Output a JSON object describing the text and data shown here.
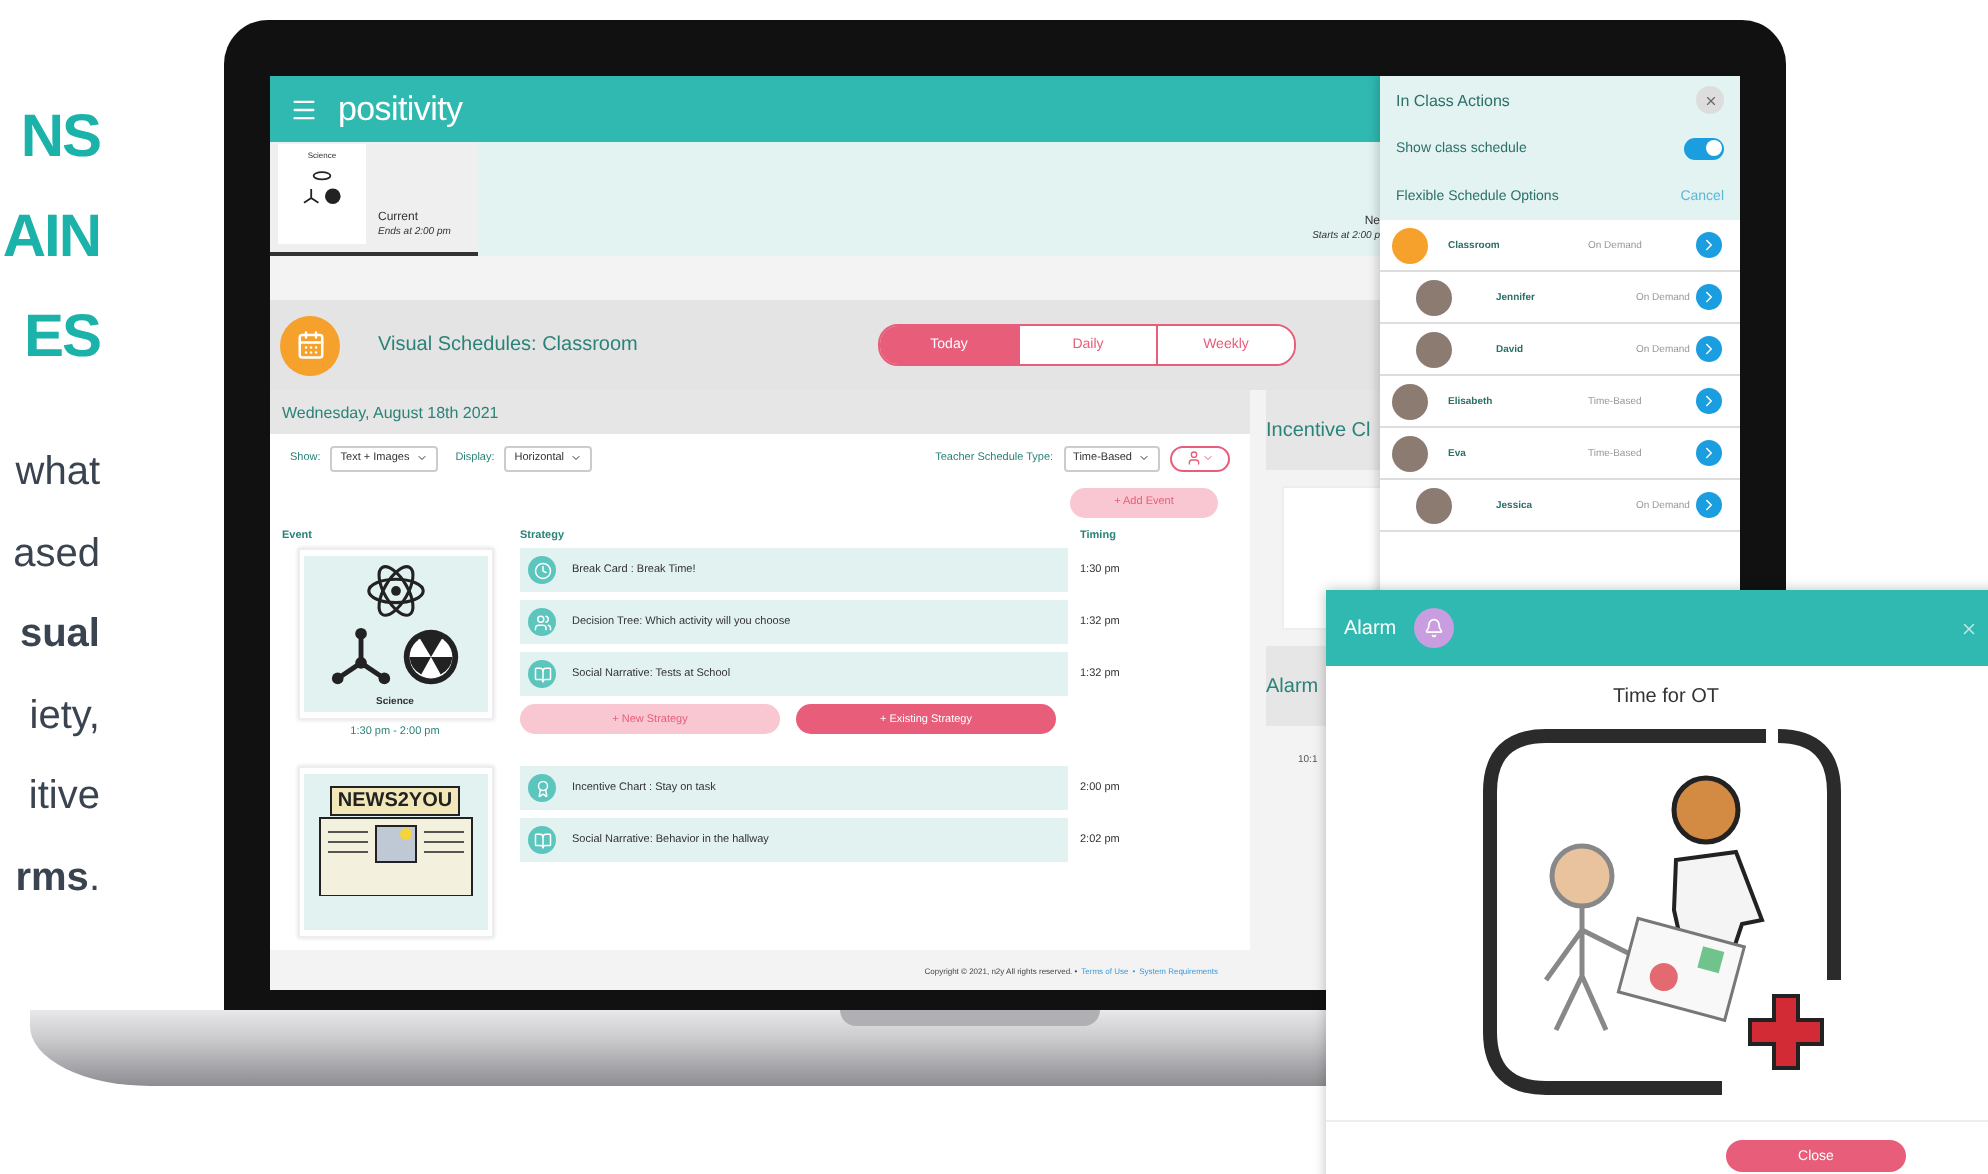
{
  "headline": [
    "NS",
    "AIN",
    "ES"
  ],
  "intro_lines": [
    {
      "text": "what",
      "bold": false
    },
    {
      "text": "ased",
      "bold": false
    },
    {
      "text": "sual",
      "bold": true
    },
    {
      "text": "iety,",
      "bold": false
    },
    {
      "text": "itive",
      "bold": false
    },
    {
      "text": "**rms**.",
      "bold": false
    }
  ],
  "app": {
    "logo": "positivity",
    "current": {
      "event": "Science",
      "label": "Current",
      "time": "Ends at 2:00 pm"
    },
    "next": {
      "label": "Ne",
      "time": "Starts at 2:00 p"
    },
    "title": "Visual Schedules: Classroom",
    "tabs": [
      {
        "label": "Today",
        "selected": true
      },
      {
        "label": "Daily",
        "selected": false
      },
      {
        "label": "Weekly",
        "selected": false
      }
    ],
    "date": "Wednesday, August 18th 2021",
    "filters": [
      {
        "label": "Show:",
        "value": "Text + Images"
      },
      {
        "label": "Display:",
        "value": "Horizontal"
      }
    ],
    "schedule_type": {
      "label": "Teacher Schedule Type:",
      "value": "Time-Based"
    },
    "add_event": "+ Add Event",
    "columns": [
      "Event",
      "Strategy",
      "Timing"
    ],
    "events": [
      {
        "kind": "science",
        "name": "Science",
        "time": "1:30 pm - 2:00 pm",
        "strategies": [
          {
            "kind": "break_card",
            "text": "Break Card : Break Time!",
            "time": "1:30 pm"
          },
          {
            "kind": "decision_tree",
            "text": "Decision Tree: Which activity will you choose",
            "time": "1:32 pm"
          },
          {
            "kind": "social_narrative",
            "text": "Social Narrative: Tests at School",
            "time": "1:32 pm"
          }
        ],
        "buttons": [
          "+ New Strategy",
          "+ Existing Strategy"
        ]
      },
      {
        "kind": "news",
        "name": "NEWS2YOU",
        "strategies": [
          {
            "kind": "incentive_chart",
            "text": "Incentive Chart : Stay on task",
            "time": "2:00 pm"
          },
          {
            "kind": "social_narrative",
            "text": "Social Narrative: Behavior in the hallway",
            "time": "2:02 pm"
          }
        ]
      }
    ],
    "side": {
      "incentive": "Incentive Cl",
      "alarms": "Alarm",
      "alarm_time": "10:1"
    },
    "footer": {
      "text": "Copyright © 2021, n2y All rights reserved. •",
      "links": [
        "Terms of Use",
        "System Requirements"
      ],
      "separator": "•"
    }
  },
  "panel": {
    "title": "In Class Actions",
    "toggle": {
      "label": "Show class schedule",
      "on": true
    },
    "options_label": "Flexible Schedule Options",
    "cancel": "Cancel",
    "items": [
      {
        "kind": "class",
        "name": "Classroom",
        "type": "On Demand",
        "children": [
          {
            "kind": "person",
            "name": "Jennifer",
            "type": "On Demand"
          },
          {
            "kind": "person",
            "name": "David",
            "type": "On Demand"
          }
        ]
      },
      {
        "kind": "person",
        "name": "Elisabeth",
        "type": "Time-Based"
      },
      {
        "kind": "person",
        "name": "Eva",
        "type": "Time-Based",
        "children": [
          {
            "kind": "person",
            "name": "Jessica",
            "type": "On Demand"
          }
        ]
      }
    ]
  },
  "alarm": {
    "title": "Alarm",
    "message": "Time for OT",
    "close": "Close"
  }
}
